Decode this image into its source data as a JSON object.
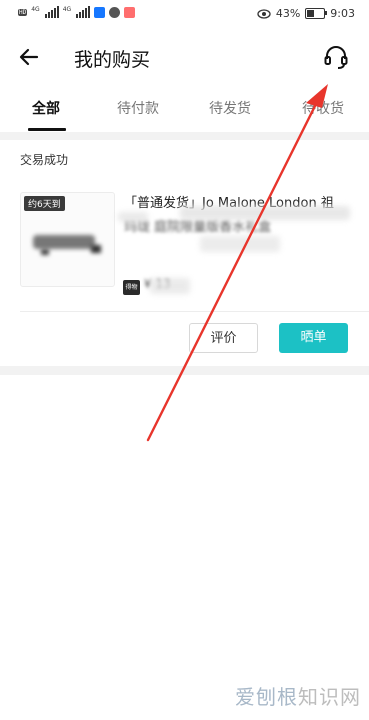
{
  "status_bar": {
    "network_left": "4G",
    "network_right": "4G",
    "battery_percent": "43%",
    "battery_level": 0.43,
    "time": "9:03",
    "app_icons": [
      "alipay-icon",
      "message-bubble-icon",
      "app-icon"
    ]
  },
  "header": {
    "title": "我的购买"
  },
  "tabs": [
    {
      "label": "全部",
      "active": true
    },
    {
      "label": "待付款",
      "active": false
    },
    {
      "label": "待发货",
      "active": false
    },
    {
      "label": "待收货",
      "active": false
    }
  ],
  "order": {
    "status": "交易成功",
    "shipping_tag": "约6天到",
    "product_title_line1": "「普通发货」Jo Malone London 祖",
    "product_title_line2": "玛珑 庭院限量版香水礼盒",
    "badge": "得物",
    "price": "¥ 13",
    "actions": {
      "review": "评价",
      "share": "晒单"
    }
  },
  "annotation": {
    "color": "#e8352c"
  },
  "watermark": {
    "part1": "爱刨根",
    "part2": "知识网"
  }
}
